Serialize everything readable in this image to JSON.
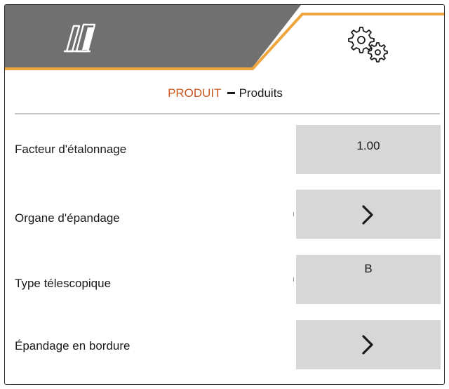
{
  "tabs": [
    {
      "name": "product",
      "icon": "spreader-icon"
    },
    {
      "name": "settings",
      "icon": "gears-icon"
    }
  ],
  "colors": {
    "tab_inactive": "#707070",
    "tab_accent": "#f0a43c",
    "breadcrumb_active": "#c9551f",
    "value_box": "#d7d7d7"
  },
  "breadcrumb": {
    "section": "PRODUIT",
    "current": "Produits"
  },
  "rows": [
    {
      "label": "Facteur d'étalonnage",
      "value": "1.00"
    },
    {
      "label": "Organe d'épandage",
      "icon": "chevron-right-icon"
    },
    {
      "label": "Type télescopique",
      "value": "B"
    },
    {
      "label": "Épandage en bordure",
      "icon": "chevron-right-icon"
    }
  ]
}
